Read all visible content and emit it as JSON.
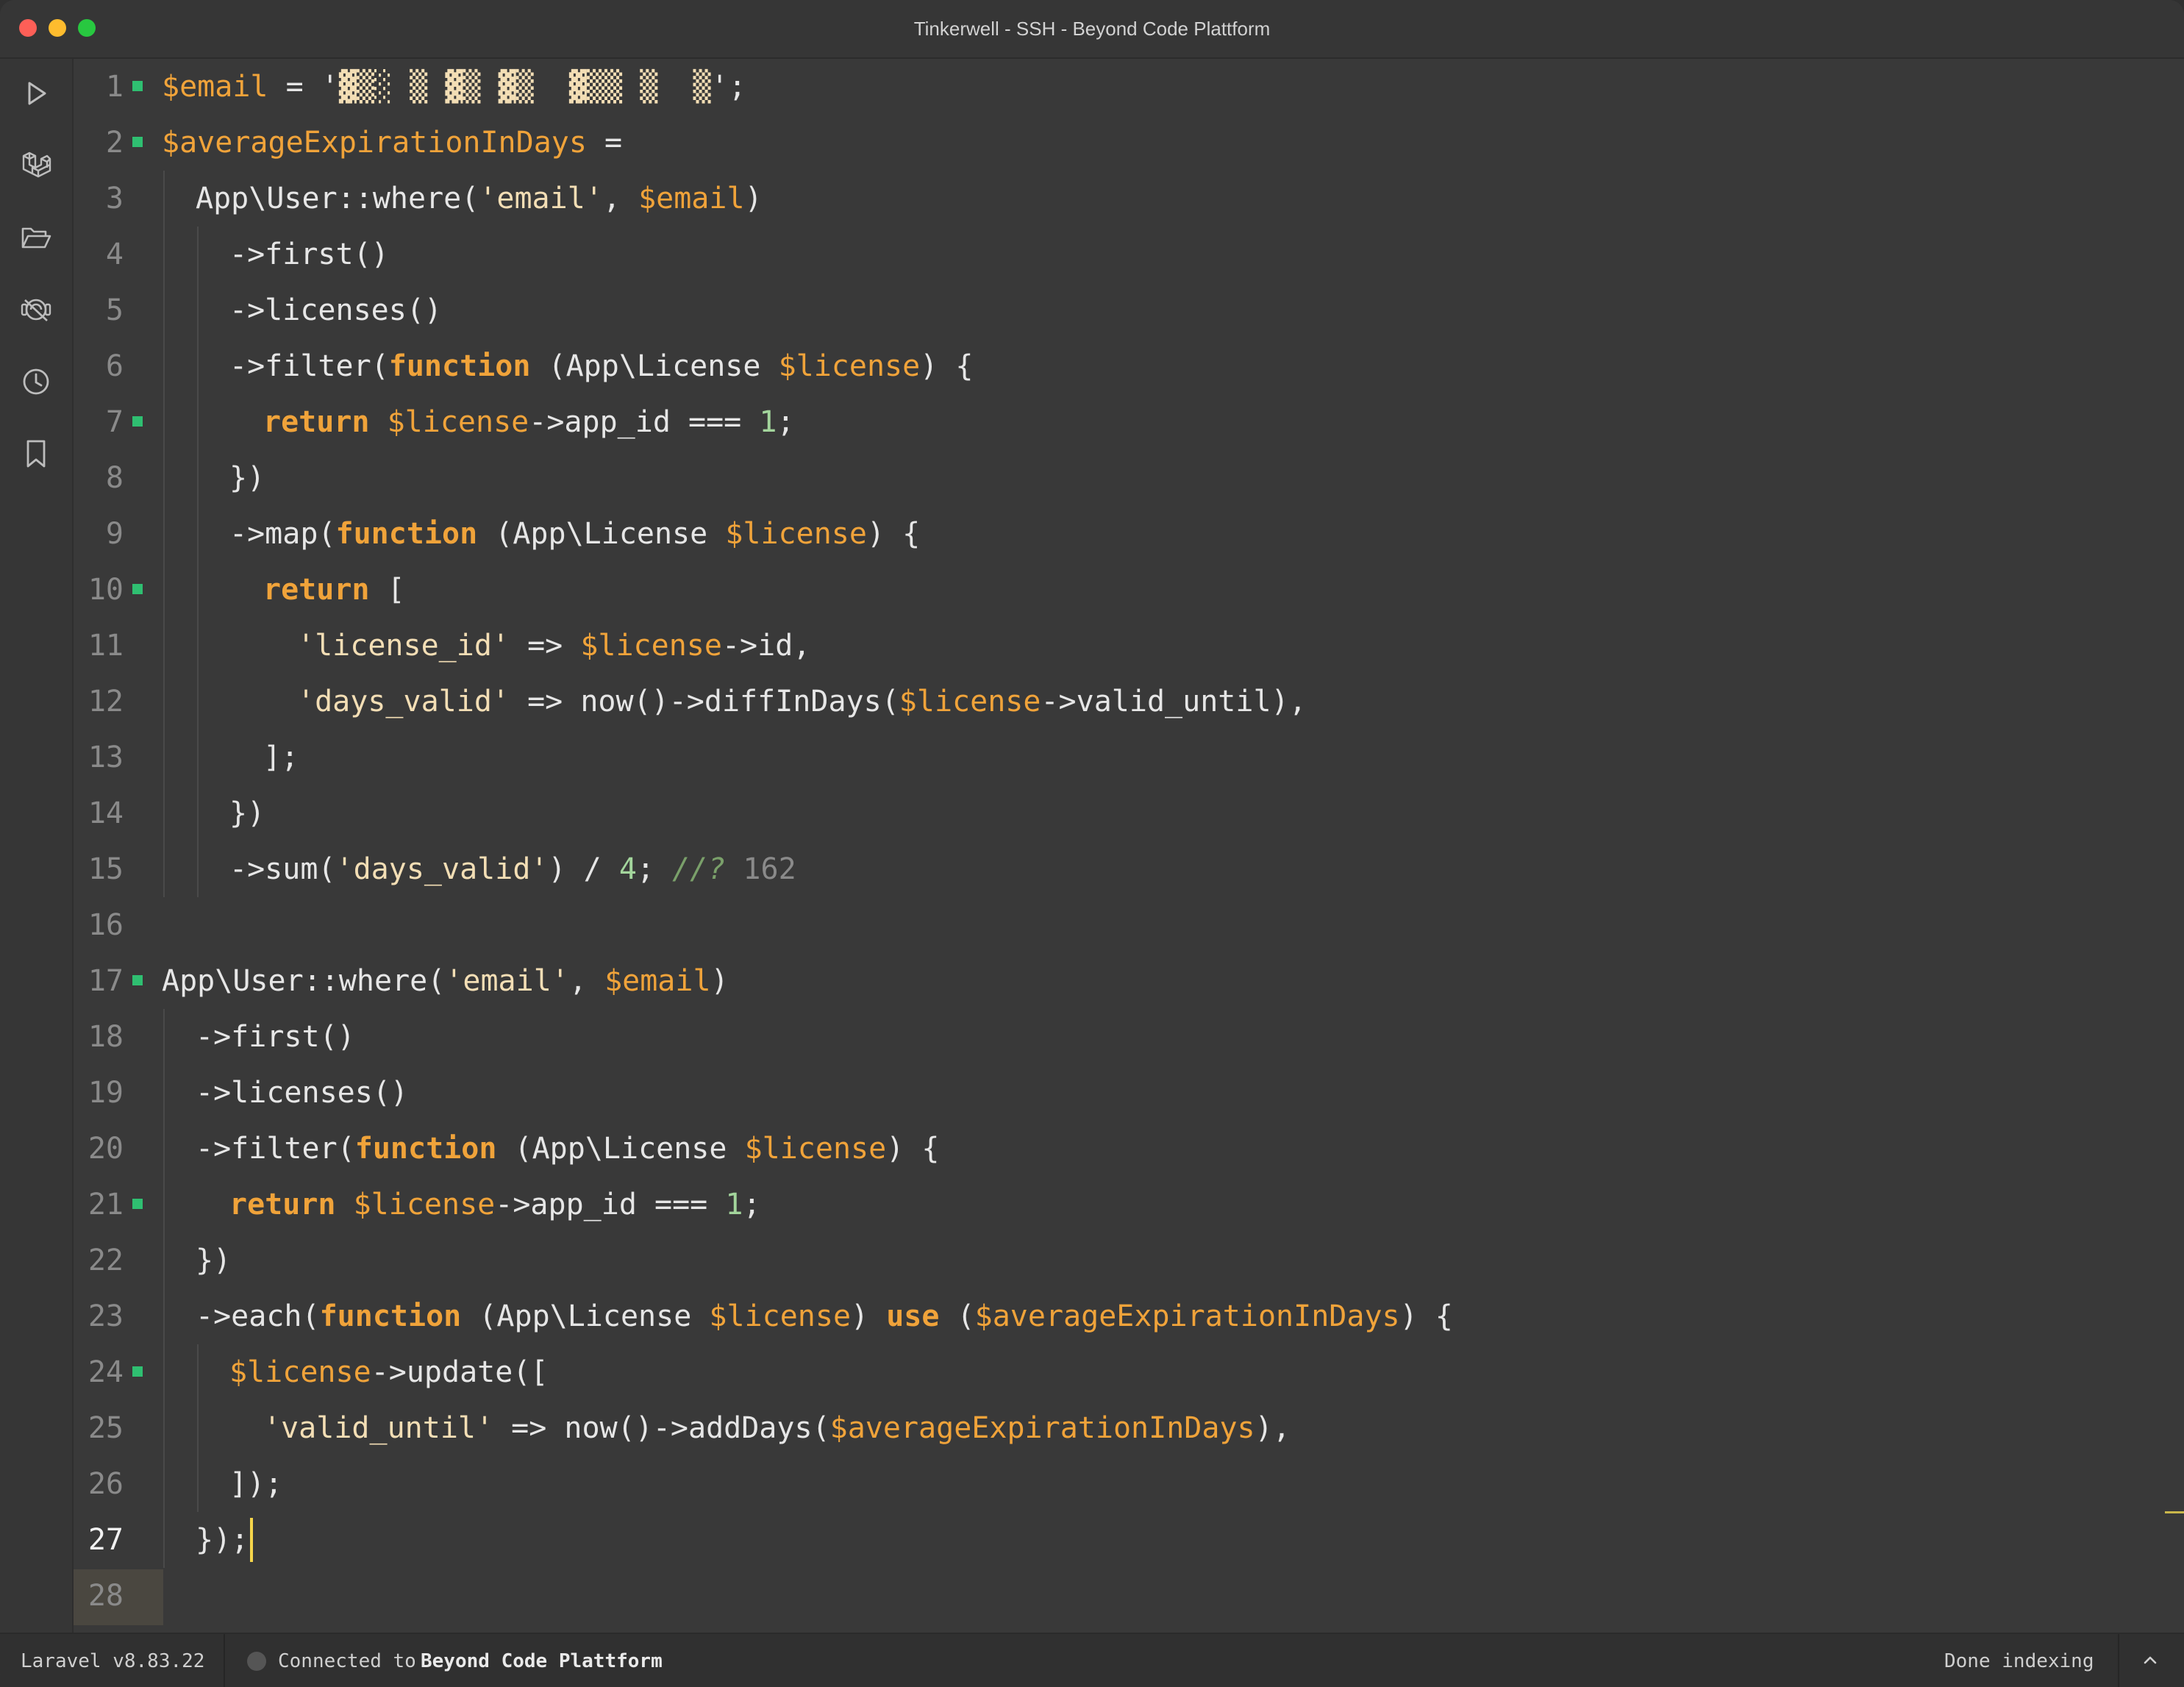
{
  "window": {
    "title": "Tinkerwell - SSH - Beyond Code Plattform"
  },
  "sidebar": {
    "icons": [
      {
        "name": "run-icon"
      },
      {
        "name": "laravel-icon"
      },
      {
        "name": "folder-icon"
      },
      {
        "name": "remote-off-icon"
      },
      {
        "name": "history-icon"
      },
      {
        "name": "bookmark-icon"
      }
    ],
    "settings_icon": "gear-icon"
  },
  "editor": {
    "current_line": 27,
    "lines": [
      {
        "num": "1",
        "marked": true,
        "indent": 0,
        "tokens": [
          {
            "t": "$email",
            "c": "var"
          },
          {
            "t": " = '",
            "c": "plain"
          },
          {
            "t": "▓▒░ ▒ ▓▒ ▓▒  ▓▒▒ ▒  ▒",
            "c": "str"
          },
          {
            "t": "';",
            "c": "plain"
          }
        ]
      },
      {
        "num": "2",
        "marked": true,
        "indent": 0,
        "tokens": [
          {
            "t": "$averageExpirationInDays",
            "c": "var"
          },
          {
            "t": " =",
            "c": "plain"
          }
        ]
      },
      {
        "num": "3",
        "marked": false,
        "indent": 1,
        "tokens": [
          {
            "t": "App\\User::where(",
            "c": "plain"
          },
          {
            "t": "'email'",
            "c": "str"
          },
          {
            "t": ", ",
            "c": "plain"
          },
          {
            "t": "$email",
            "c": "var"
          },
          {
            "t": ")",
            "c": "plain"
          }
        ]
      },
      {
        "num": "4",
        "marked": false,
        "indent": 2,
        "tokens": [
          {
            "t": "->first()",
            "c": "plain"
          }
        ]
      },
      {
        "num": "5",
        "marked": false,
        "indent": 2,
        "tokens": [
          {
            "t": "->licenses()",
            "c": "plain"
          }
        ]
      },
      {
        "num": "6",
        "marked": false,
        "indent": 2,
        "tokens": [
          {
            "t": "->filter(",
            "c": "plain"
          },
          {
            "t": "function",
            "c": "kw"
          },
          {
            "t": " (App\\License ",
            "c": "plain"
          },
          {
            "t": "$license",
            "c": "var"
          },
          {
            "t": ") {",
            "c": "plain"
          }
        ]
      },
      {
        "num": "7",
        "marked": true,
        "indent": 3,
        "tokens": [
          {
            "t": "return",
            "c": "kw"
          },
          {
            "t": " ",
            "c": "plain"
          },
          {
            "t": "$license",
            "c": "var"
          },
          {
            "t": "->app_id === ",
            "c": "plain"
          },
          {
            "t": "1",
            "c": "num"
          },
          {
            "t": ";",
            "c": "plain"
          }
        ]
      },
      {
        "num": "8",
        "marked": false,
        "indent": 2,
        "tokens": [
          {
            "t": "})",
            "c": "plain"
          }
        ]
      },
      {
        "num": "9",
        "marked": false,
        "indent": 2,
        "tokens": [
          {
            "t": "->map(",
            "c": "plain"
          },
          {
            "t": "function",
            "c": "kw"
          },
          {
            "t": " (App\\License ",
            "c": "plain"
          },
          {
            "t": "$license",
            "c": "var"
          },
          {
            "t": ") {",
            "c": "plain"
          }
        ]
      },
      {
        "num": "10",
        "marked": true,
        "indent": 3,
        "tokens": [
          {
            "t": "return",
            "c": "kw"
          },
          {
            "t": " [",
            "c": "plain"
          }
        ]
      },
      {
        "num": "11",
        "marked": false,
        "indent": 4,
        "tokens": [
          {
            "t": "'license_id'",
            "c": "str"
          },
          {
            "t": " => ",
            "c": "plain"
          },
          {
            "t": "$license",
            "c": "var"
          },
          {
            "t": "->id,",
            "c": "plain"
          }
        ]
      },
      {
        "num": "12",
        "marked": false,
        "indent": 4,
        "tokens": [
          {
            "t": "'days_valid'",
            "c": "str"
          },
          {
            "t": " => now()->diffInDays(",
            "c": "plain"
          },
          {
            "t": "$license",
            "c": "var"
          },
          {
            "t": "->valid_until),",
            "c": "plain"
          }
        ]
      },
      {
        "num": "13",
        "marked": false,
        "indent": 3,
        "tokens": [
          {
            "t": "];",
            "c": "plain"
          }
        ]
      },
      {
        "num": "14",
        "marked": false,
        "indent": 2,
        "tokens": [
          {
            "t": "})",
            "c": "plain"
          }
        ]
      },
      {
        "num": "15",
        "marked": false,
        "indent": 2,
        "tokens": [
          {
            "t": "->sum(",
            "c": "plain"
          },
          {
            "t": "'days_valid'",
            "c": "str"
          },
          {
            "t": ") / ",
            "c": "plain"
          },
          {
            "t": "4",
            "c": "num"
          },
          {
            "t": "; ",
            "c": "plain"
          },
          {
            "t": "//?",
            "c": "cmt-mark"
          },
          {
            "t": " 162",
            "c": "res"
          }
        ]
      },
      {
        "num": "16",
        "marked": false,
        "indent": 0,
        "tokens": []
      },
      {
        "num": "17",
        "marked": true,
        "indent": 0,
        "tokens": [
          {
            "t": "App\\User::where(",
            "c": "plain"
          },
          {
            "t": "'email'",
            "c": "str"
          },
          {
            "t": ", ",
            "c": "plain"
          },
          {
            "t": "$email",
            "c": "var"
          },
          {
            "t": ")",
            "c": "plain"
          }
        ]
      },
      {
        "num": "18",
        "marked": false,
        "indent": 1,
        "tokens": [
          {
            "t": "->first()",
            "c": "plain"
          }
        ]
      },
      {
        "num": "19",
        "marked": false,
        "indent": 1,
        "tokens": [
          {
            "t": "->licenses()",
            "c": "plain"
          }
        ]
      },
      {
        "num": "20",
        "marked": false,
        "indent": 1,
        "tokens": [
          {
            "t": "->filter(",
            "c": "plain"
          },
          {
            "t": "function",
            "c": "kw"
          },
          {
            "t": " (App\\License ",
            "c": "plain"
          },
          {
            "t": "$license",
            "c": "var"
          },
          {
            "t": ") {",
            "c": "plain"
          }
        ]
      },
      {
        "num": "21",
        "marked": true,
        "indent": 2,
        "tokens": [
          {
            "t": "return",
            "c": "kw"
          },
          {
            "t": " ",
            "c": "plain"
          },
          {
            "t": "$license",
            "c": "var"
          },
          {
            "t": "->app_id === ",
            "c": "plain"
          },
          {
            "t": "1",
            "c": "num"
          },
          {
            "t": ";",
            "c": "plain"
          }
        ]
      },
      {
        "num": "22",
        "marked": false,
        "indent": 1,
        "tokens": [
          {
            "t": "})",
            "c": "plain"
          }
        ]
      },
      {
        "num": "23",
        "marked": false,
        "indent": 1,
        "tokens": [
          {
            "t": "->each(",
            "c": "plain"
          },
          {
            "t": "function",
            "c": "kw"
          },
          {
            "t": " (App\\License ",
            "c": "plain"
          },
          {
            "t": "$license",
            "c": "var"
          },
          {
            "t": ") ",
            "c": "plain"
          },
          {
            "t": "use",
            "c": "kw"
          },
          {
            "t": " (",
            "c": "plain"
          },
          {
            "t": "$averageExpirationInDays",
            "c": "var"
          },
          {
            "t": ") {",
            "c": "plain"
          }
        ]
      },
      {
        "num": "24",
        "marked": true,
        "indent": 2,
        "tokens": [
          {
            "t": "$license",
            "c": "var"
          },
          {
            "t": "->update([",
            "c": "plain"
          }
        ]
      },
      {
        "num": "25",
        "marked": false,
        "indent": 3,
        "tokens": [
          {
            "t": "'valid_until'",
            "c": "str"
          },
          {
            "t": " => now()->addDays(",
            "c": "plain"
          },
          {
            "t": "$averageExpirationInDays",
            "c": "var"
          },
          {
            "t": "),",
            "c": "plain"
          }
        ]
      },
      {
        "num": "26",
        "marked": false,
        "indent": 2,
        "tokens": [
          {
            "t": "]);",
            "c": "plain"
          }
        ]
      },
      {
        "num": "27",
        "marked": false,
        "indent": 1,
        "tokens": [
          {
            "t": "});",
            "c": "plain"
          }
        ]
      },
      {
        "num": "28",
        "marked": false,
        "indent": 0,
        "tokens": []
      }
    ]
  },
  "statusbar": {
    "framework": "Laravel v8.83.22",
    "connection_prefix": "Connected to",
    "connection_name": "Beyond Code Plattform",
    "indexing": "Done indexing",
    "chevron_icon": "chevron-up-icon"
  },
  "colors": {
    "variable": "#f0a33a",
    "keyword": "#f0a33a",
    "string": "#f3deb5",
    "number": "#a3d59c",
    "changed_marker": "#2fbf71",
    "cursor": "#f5d54a"
  }
}
